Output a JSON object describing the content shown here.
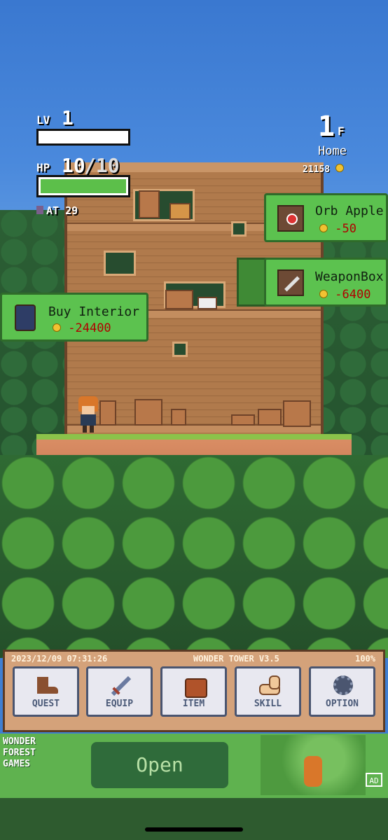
{
  "hud": {
    "level_label": "LV",
    "level_value": "1",
    "level_progress": 0,
    "hp_label": "HP",
    "hp_current": "10",
    "hp_max": "/10",
    "hp_fraction": 1.0,
    "attack": "AT 29",
    "floor_number": "1",
    "floor_suffix": "F",
    "location": "Home",
    "gold": "21158"
  },
  "offers": [
    {
      "title": "Orb Apple",
      "price": "-50",
      "icon": "orb-apple-chest-icon"
    },
    {
      "title": "WeaponBox",
      "price": "-6400",
      "icon": "sword-icon"
    },
    {
      "title": "Buy Interior",
      "price": "-24400",
      "icon": "jar-icon"
    }
  ],
  "status_bar": {
    "datetime": "2023/12/09 07:31:26",
    "game_title": "WONDER TOWER V3.5",
    "battery": "100%"
  },
  "menu": [
    {
      "label": "QUEST",
      "icon": "boot-icon"
    },
    {
      "label": "EQUIP",
      "icon": "sword-icon"
    },
    {
      "label": "ITEM",
      "icon": "bag-icon"
    },
    {
      "label": "SKILL",
      "icon": "arm-icon"
    },
    {
      "label": "OPTION",
      "icon": "gear-icon"
    }
  ],
  "ad": {
    "logo_text": "WONDER FOREST GAMES",
    "open_label": "Open",
    "badge": "AD"
  },
  "colors": {
    "sky": "#4a89dc",
    "bubble": "#5cc24f",
    "price": "#b10000",
    "hp_bar": "#5cbf4a"
  }
}
